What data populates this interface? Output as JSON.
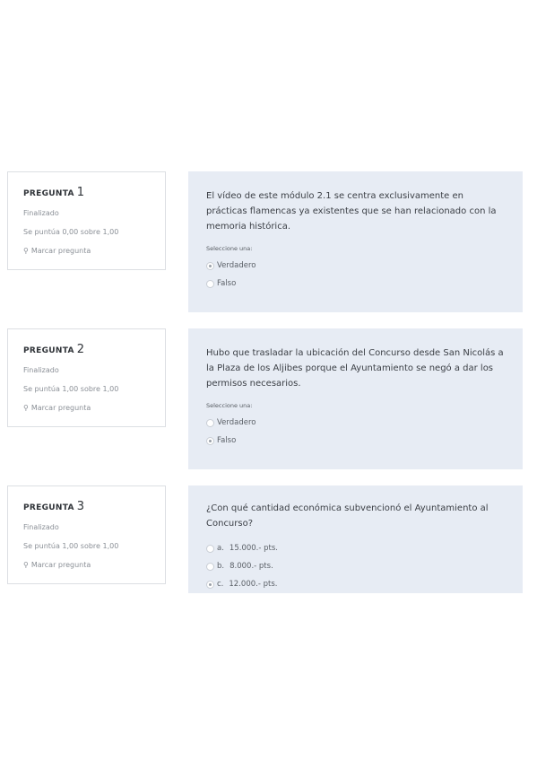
{
  "questions": [
    {
      "label": "PREGUNTA",
      "number": "1",
      "state": "Finalizado",
      "score": "Se puntúa 0,00 sobre 1,00",
      "flag_label": "Marcar pregunta",
      "text": "El vídeo de este módulo 2.1 se centra exclusivamente en prácticas flamencas ya existentes que se han relacionado con la memoria histórica.",
      "prompt": "Seleccione una:",
      "options": [
        {
          "letter": "",
          "label": "Verdadero",
          "selected": true
        },
        {
          "letter": "",
          "label": "Falso",
          "selected": false
        }
      ]
    },
    {
      "label": "PREGUNTA",
      "number": "2",
      "state": "Finalizado",
      "score": "Se puntúa 1,00 sobre 1,00",
      "flag_label": "Marcar pregunta",
      "text": "Hubo que trasladar la ubicación del Concurso desde San Nicolás a la Plaza de los Aljibes porque el Ayuntamiento se negó a dar los permisos necesarios.",
      "prompt": "Seleccione una:",
      "options": [
        {
          "letter": "",
          "label": "Verdadero",
          "selected": false
        },
        {
          "letter": "",
          "label": "Falso",
          "selected": true
        }
      ]
    },
    {
      "label": "PREGUNTA",
      "number": "3",
      "state": "Finalizado",
      "score": "Se puntúa 1,00 sobre 1,00",
      "flag_label": "Marcar pregunta",
      "text": "¿Con qué cantidad económica subvencionó el Ayuntamiento al Concurso?",
      "prompt": "",
      "options": [
        {
          "letter": "a.",
          "label": "15.000.- pts.",
          "selected": false
        },
        {
          "letter": "b.",
          "label": "8.000.- pts.",
          "selected": false
        },
        {
          "letter": "c.",
          "label": "12.000.- pts.",
          "selected": true
        }
      ]
    }
  ]
}
